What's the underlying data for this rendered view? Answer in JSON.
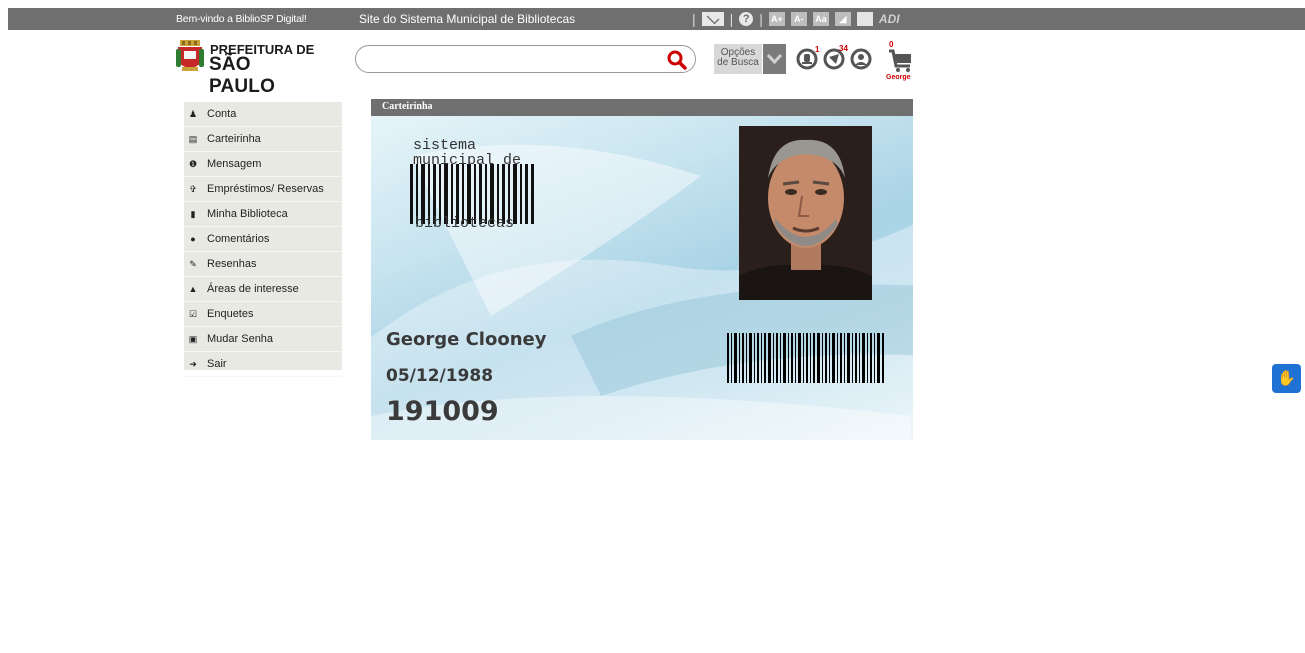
{
  "topbar": {
    "welcome": "Bem-vindo a BiblioSP Digital!",
    "site_title": "Site do Sistema Municipal de Bibliotecas",
    "font_buttons": [
      "A+",
      "A-",
      "Aa"
    ],
    "adi_label": "ADI"
  },
  "logo": {
    "line1": "PREFEITURA DE",
    "line2": "SÃO PAULO"
  },
  "search": {
    "value": "",
    "placeholder": ""
  },
  "search_options": {
    "line1": "Opções",
    "line2": "de Busca"
  },
  "badges": {
    "alerts": "1",
    "messages": "34",
    "cart": "0"
  },
  "cart_user": "George",
  "sidebar": {
    "items": [
      {
        "label": "Conta",
        "icon": "user-icon"
      },
      {
        "label": "Carteirinha",
        "icon": "card-icon"
      },
      {
        "label": "Mensagem",
        "icon": "info-icon"
      },
      {
        "label": "Empréstimos/ Reservas",
        "icon": "pin-icon"
      },
      {
        "label": "Minha Biblioteca",
        "icon": "book-icon"
      },
      {
        "label": "Comentários",
        "icon": "comment-icon"
      },
      {
        "label": "Resenhas",
        "icon": "pencil-icon"
      },
      {
        "label": "Áreas de interesse",
        "icon": "thumbs-up-icon"
      },
      {
        "label": "Enquetes",
        "icon": "edit-icon"
      },
      {
        "label": "Mudar Senha",
        "icon": "lock-icon"
      },
      {
        "label": "Sair",
        "icon": "logout-icon"
      }
    ]
  },
  "card": {
    "panel_title": "Carteirinha",
    "brand_line1": "sistema",
    "brand_line2": "municipal de",
    "brand_line3": "bibliotecas",
    "holder_name": "George Clooney",
    "birth_date": "05/12/1988",
    "card_number": "191009"
  },
  "colors": {
    "topbar": "#6f6f6f",
    "sidebar": "#e9e9e4",
    "search_icon": "#cc0000",
    "vlibras": "#1f72d4"
  }
}
